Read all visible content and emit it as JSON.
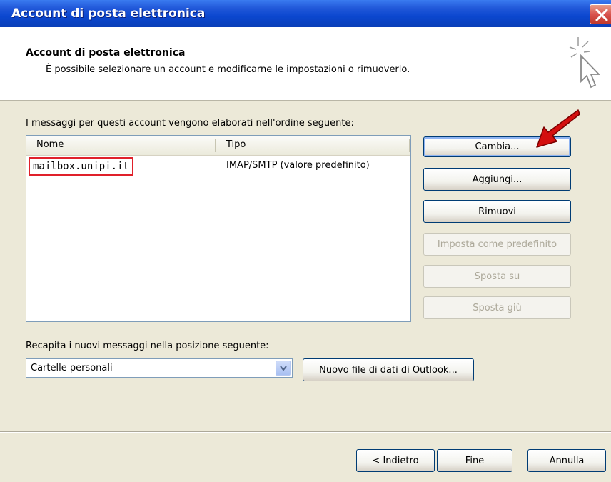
{
  "window": {
    "title": "Account di posta elettronica"
  },
  "header": {
    "title": "Account di posta elettronica",
    "description": "È possibile selezionare un account e modificarne le impostazioni o rimuoverlo."
  },
  "accounts": {
    "caption": "I messaggi per questi account vengono elaborati nell'ordine seguente:",
    "columns": {
      "name": "Nome",
      "type": "Tipo"
    },
    "rows": [
      {
        "name": "mailbox.unipi.it",
        "type": "IMAP/SMTP (valore predefinito)"
      }
    ]
  },
  "buttons": {
    "change": "Cambia...",
    "add": "Aggiungi...",
    "remove": "Rimuovi",
    "set_default": "Imposta come predefinito",
    "move_up": "Sposta su",
    "move_down": "Sposta giù"
  },
  "delivery": {
    "caption": "Recapita i nuovi messaggi nella posizione seguente:",
    "selected": "Cartelle personali",
    "new_file_button": "Nuovo file di dati di Outlook..."
  },
  "footer": {
    "back": "< Indietro",
    "finish": "Fine",
    "cancel": "Annulla"
  },
  "icons": {
    "close": "close-icon",
    "wizard": "wizard-sparkle-cursor-icon",
    "pointer_arrow": "red-pointer-arrow-icon",
    "dropdown": "chevron-down-icon"
  },
  "colors": {
    "titlebar": "#0b47cf",
    "dialog_bg": "#ece9d8",
    "highlight": "#e0202a"
  }
}
